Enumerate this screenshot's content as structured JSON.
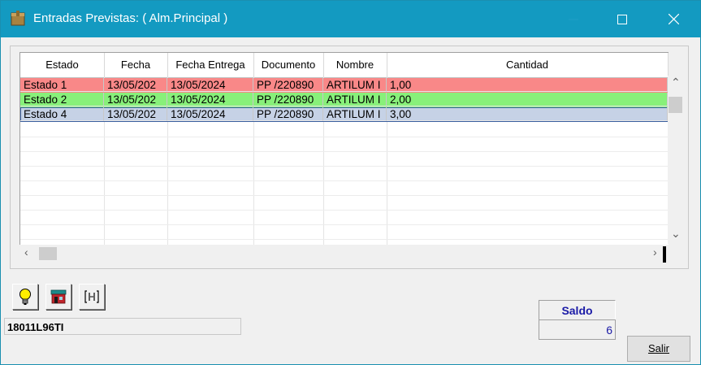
{
  "window": {
    "title": "Entradas Previstas: ( Alm.Principal )"
  },
  "grid": {
    "columns": [
      "Estado",
      "Fecha",
      "Fecha Entrega",
      "Documento",
      "Nombre",
      "Cantidad"
    ],
    "rows": [
      {
        "estado": "Estado 1",
        "fecha": "13/05/202",
        "fecha_entrega": "13/05/2024",
        "documento": "PP /220890",
        "nombre": "ARTILUM I",
        "cantidad": "1,00",
        "color": "#f98888"
      },
      {
        "estado": "Estado 2",
        "fecha": "13/05/202",
        "fecha_entrega": "13/05/2024",
        "documento": "PP /220890",
        "nombre": "ARTILUM I",
        "cantidad": "2,00",
        "color": "#88f07a"
      },
      {
        "estado": "Estado 4",
        "fecha": "13/05/202",
        "fecha_entrega": "13/05/2024",
        "documento": "PP /220890",
        "nombre": "ARTILUM I",
        "cantidad": "3,00",
        "color": "#c6d2e6"
      }
    ]
  },
  "toolbar": {
    "icons": [
      "lightbulb-icon",
      "store-icon",
      "column-width-icon"
    ]
  },
  "status": {
    "code": "18011L96TI"
  },
  "saldo": {
    "label": "Saldo",
    "value": "6"
  },
  "buttons": {
    "salir": "Salir"
  },
  "colors": {
    "titlebar": "#139ac1",
    "saldo_text": "#1a1aa6"
  }
}
